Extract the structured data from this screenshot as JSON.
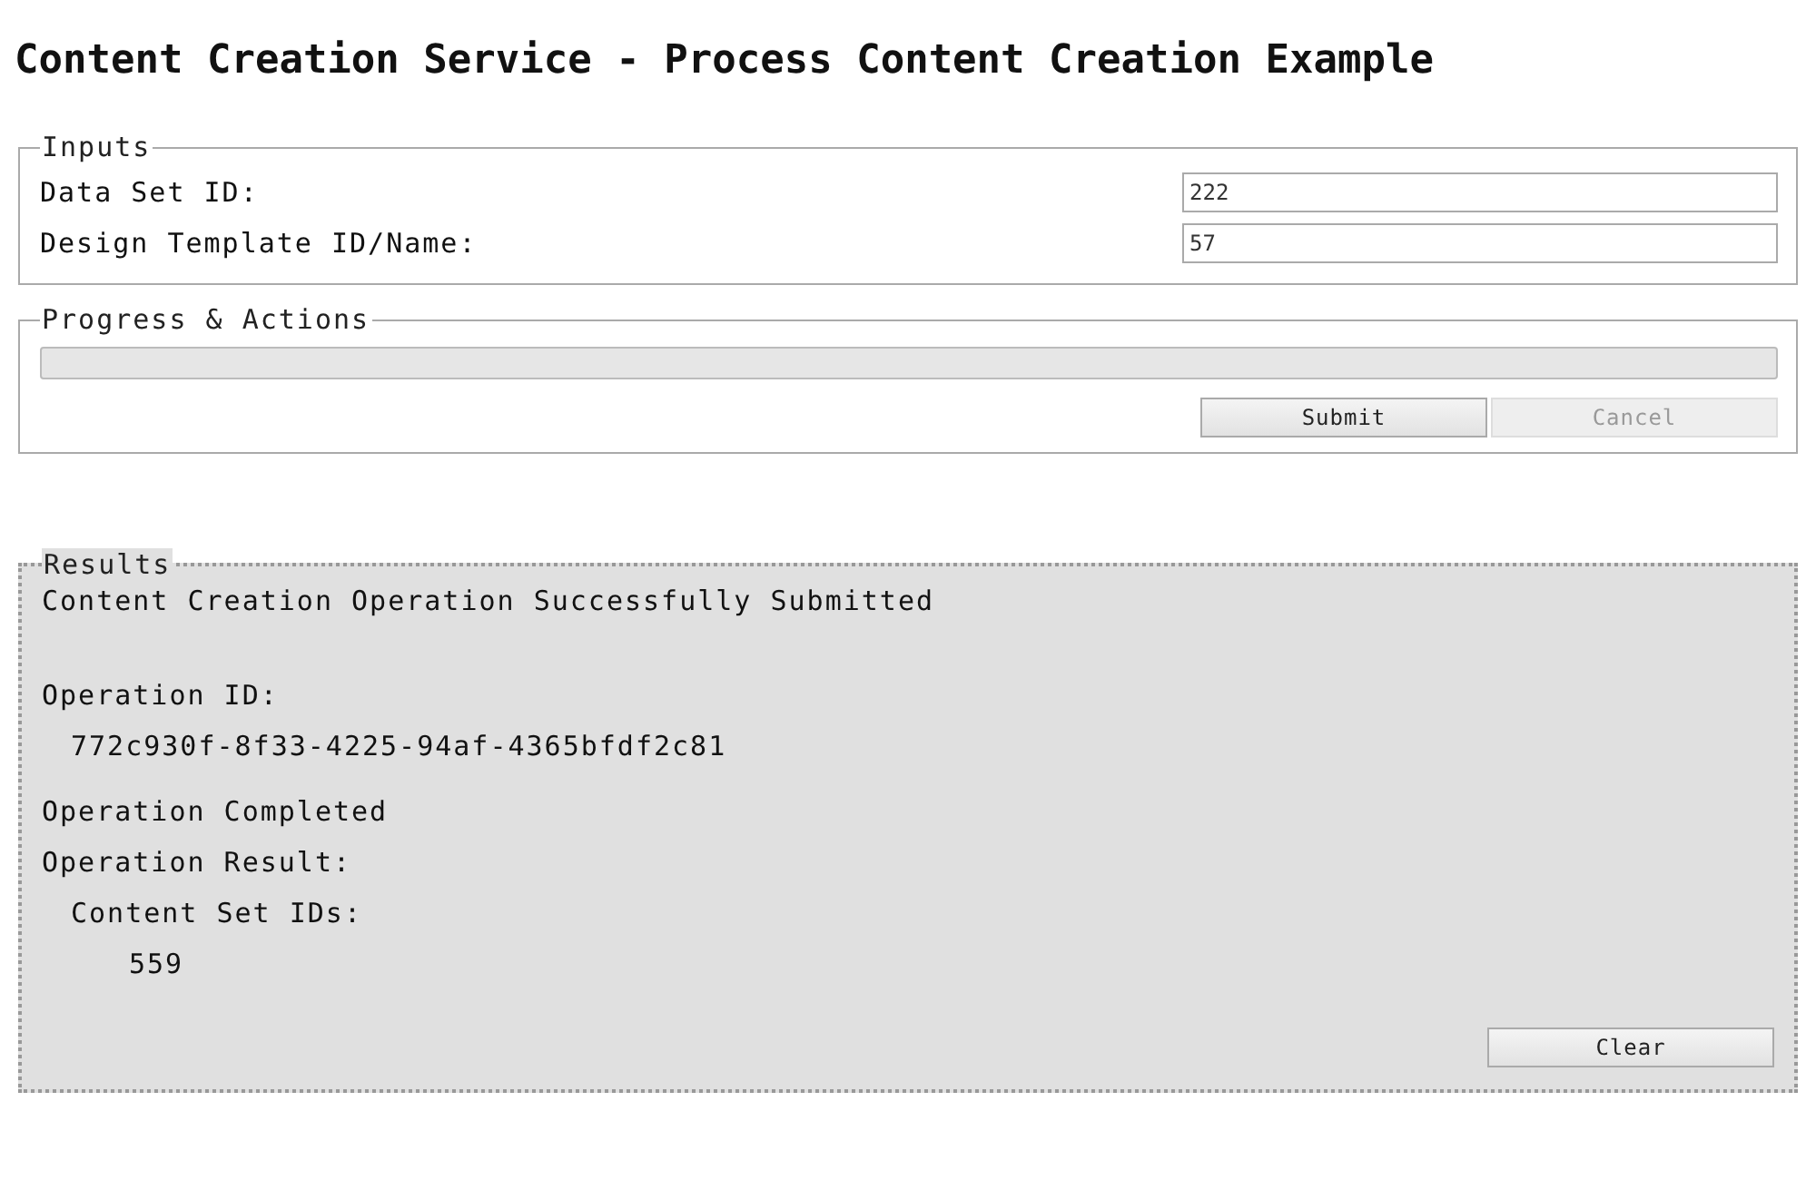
{
  "page_title": "Content Creation Service - Process Content Creation Example",
  "inputs": {
    "legend": "Inputs",
    "fields": [
      {
        "label": "Data Set ID:",
        "value": "222"
      },
      {
        "label": "Design Template ID/Name:",
        "value": "57"
      }
    ]
  },
  "progress": {
    "legend": "Progress & Actions",
    "level": 0,
    "buttons": [
      {
        "label": "Submit",
        "disabled": false
      },
      {
        "label": "Cancel",
        "disabled": true
      }
    ]
  },
  "results": {
    "legend": "Results",
    "lines": [
      {
        "kind": "message",
        "text": "Content Creation Operation Successfully Submitted"
      },
      {
        "kind": "label",
        "text": "Operation ID:"
      },
      {
        "kind": "value",
        "text": "772c930f-8f33-4225-94af-4365bfdf2c81"
      },
      {
        "kind": "label",
        "text": "Operation Completed"
      },
      {
        "kind": "label",
        "text": "Operation Result:"
      },
      {
        "kind": "sublabel",
        "text": "Content Set IDs:"
      },
      {
        "kind": "subvalue",
        "text": "559"
      }
    ],
    "button": {
      "label": "Clear",
      "disabled": false
    }
  }
}
